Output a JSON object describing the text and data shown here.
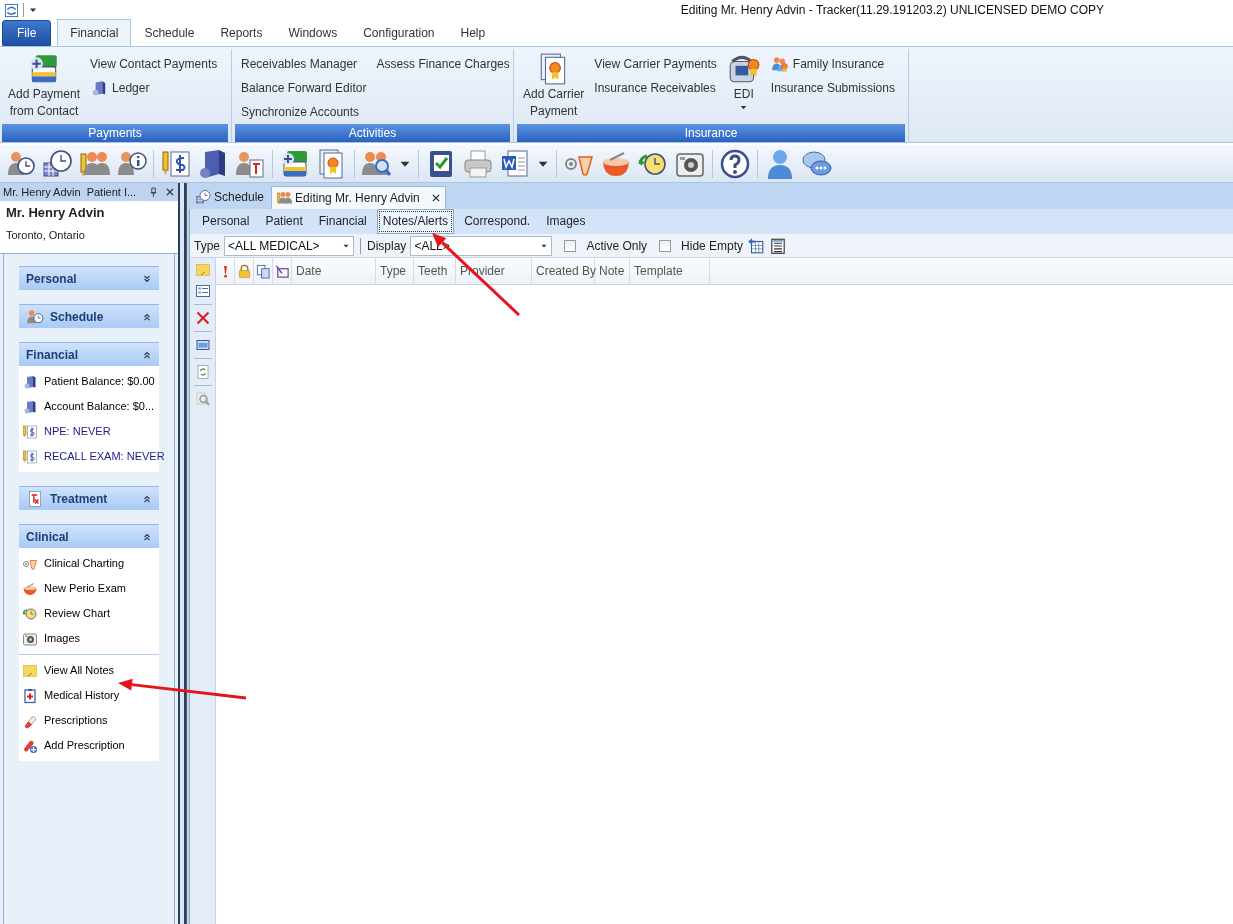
{
  "window": {
    "title": "Editing Mr. Henry Advin - Tracker(11.29.191203.2) UNLICENSED DEMO COPY"
  },
  "menu_tabs": [
    {
      "label": "File",
      "kind": "file",
      "selected": false
    },
    {
      "label": "Financial",
      "kind": "tab",
      "selected": true
    },
    {
      "label": "Schedule",
      "kind": "tab",
      "selected": false
    },
    {
      "label": "Reports",
      "kind": "tab",
      "selected": false
    },
    {
      "label": "Windows",
      "kind": "tab",
      "selected": false
    },
    {
      "label": "Configuration",
      "kind": "tab",
      "selected": false
    },
    {
      "label": "Help",
      "kind": "tab",
      "selected": false
    }
  ],
  "ribbon_groups": [
    {
      "title": "Payments",
      "columns": [
        [
          {
            "label": "Add Payment\nfrom Contact",
            "kind": "large"
          }
        ],
        [
          {
            "label": "View Contact Payments",
            "kind": "small"
          },
          {
            "label": "Ledger",
            "kind": "small-icon"
          }
        ]
      ]
    },
    {
      "title": "Activities",
      "columns": [
        [
          {
            "label": "Receivables Manager",
            "kind": "small"
          },
          {
            "label": "Balance Forward Editor",
            "kind": "small"
          },
          {
            "label": "Synchronize Accounts",
            "kind": "small"
          }
        ],
        [
          {
            "label": "Assess Finance Charges",
            "kind": "small"
          }
        ]
      ]
    },
    {
      "title": "Insurance",
      "columns": [
        [
          {
            "label": "Add Carrier\nPayment",
            "kind": "large"
          }
        ],
        [
          {
            "label": "View Carrier Payments",
            "kind": "small"
          },
          {
            "label": "Insurance Receivables",
            "kind": "small"
          }
        ],
        [
          {
            "label": "EDI",
            "kind": "large-menu"
          }
        ],
        [
          {
            "label": "Family Insurance",
            "kind": "small-icon"
          },
          {
            "label": "Insurance Submissions",
            "kind": "small"
          }
        ]
      ]
    }
  ],
  "side_panel": {
    "title": "Mr. Henry Advin",
    "title_cut": "Patient I...",
    "patient_name": "Mr. Henry Advin",
    "location": "Toronto, Ontario",
    "groups": [
      {
        "title": "Personal",
        "expanded": false
      },
      {
        "title": "Schedule",
        "expanded": true
      },
      {
        "title": "Financial",
        "expanded": true,
        "sections": [
          [
            {
              "label": "Patient Balance: $0.00",
              "color": "#000000"
            },
            {
              "label": "Account  Balance: $0...",
              "color": "#000000"
            },
            {
              "label": "NPE: NEVER",
              "color": "#1c1c8c"
            },
            {
              "label": "RECALL EXAM: NEVER",
              "color": "#1c1c8c"
            }
          ]
        ]
      },
      {
        "title": "Treatment",
        "expanded": true
      },
      {
        "title": "Clinical",
        "expanded": true,
        "sections": [
          [
            {
              "label": "Clinical Charting"
            },
            {
              "label": "New Perio Exam"
            },
            {
              "label": "Review Chart"
            },
            {
              "label": "Images"
            }
          ],
          [
            {
              "label": "View All Notes"
            },
            {
              "label": "Medical History"
            },
            {
              "label": "Prescriptions"
            },
            {
              "label": "Add Prescription"
            }
          ]
        ]
      }
    ]
  },
  "doc_tabs": [
    {
      "label": "Schedule",
      "selected": false
    },
    {
      "label": "Editing Mr. Henry Advin",
      "selected": true
    }
  ],
  "sub_tabs": [
    {
      "label": "Personal",
      "selected": false
    },
    {
      "label": "Patient",
      "selected": false
    },
    {
      "label": "Financial",
      "selected": false
    },
    {
      "label": "Notes/Alerts",
      "selected": true
    },
    {
      "label": "Correspond.",
      "selected": false
    },
    {
      "label": "Images",
      "selected": false
    }
  ],
  "filters": {
    "type_label": "Type",
    "type_value": "<ALL MEDICAL>",
    "display_label": "Display",
    "display_value": "<ALL>",
    "checkboxes": [
      {
        "label": "Active Only",
        "checked": false
      },
      {
        "label": "Hide Empty",
        "checked": false
      }
    ]
  },
  "grid": {
    "columns": [
      "Date",
      "Type",
      "Teeth",
      "Provider",
      "Created By",
      "Note",
      "Template"
    ]
  }
}
